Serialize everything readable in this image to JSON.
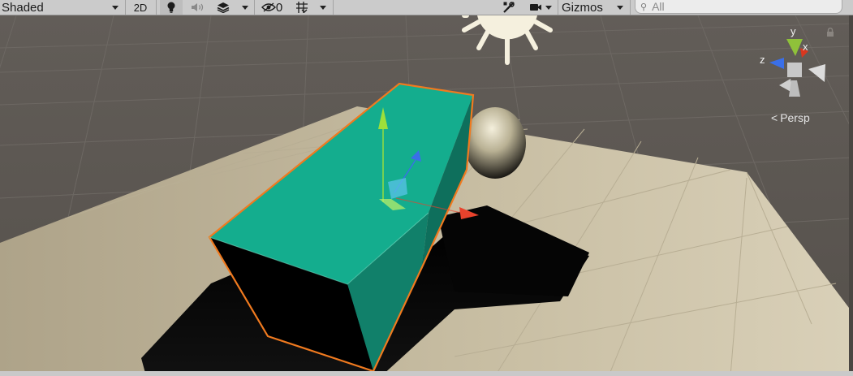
{
  "toolbar": {
    "shading_mode": "Shaded",
    "mode_2d_label": "2D",
    "hidden_objects_count": "0",
    "gizmos_label": "Gizmos",
    "search_placeholder": "All"
  },
  "gizmo": {
    "axis_y": "y",
    "axis_x": "x",
    "axis_z": "z",
    "projection": "Persp"
  },
  "colors": {
    "selection_outline": "#f07a1f",
    "cube_top": "#12a98a",
    "axis_x": "#e8422c",
    "axis_y": "#9de03a",
    "axis_z": "#3a6fe8"
  },
  "icons": [
    "lightbulb-icon",
    "audio-icon",
    "effects-layers-icon",
    "hidden-objects-eye-icon",
    "grid-icon",
    "tools-icon",
    "camera-icon",
    "search-icon",
    "lock-icon",
    "sun-light-icon"
  ]
}
